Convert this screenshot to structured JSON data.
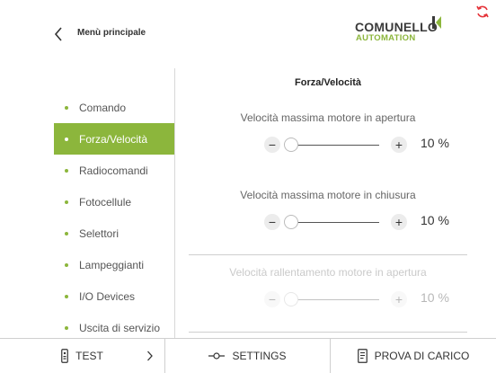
{
  "header": {
    "back_title": "Menù principale",
    "logo_word": "COMUNELLO",
    "logo_sub": "AUTOMATION",
    "brand_color": "#8cb63c",
    "sync_icon_color": "#e5343a"
  },
  "sidebar": {
    "items": [
      {
        "label": "Comando",
        "active": false
      },
      {
        "label": "Forza/Velocità",
        "active": true
      },
      {
        "label": "Radiocomandi",
        "active": false
      },
      {
        "label": "Fotocellule",
        "active": false
      },
      {
        "label": "Selettori",
        "active": false
      },
      {
        "label": "Lampeggianti",
        "active": false
      },
      {
        "label": "I/O Devices",
        "active": false
      },
      {
        "label": "Uscita di servizio",
        "active": false
      }
    ]
  },
  "panel": {
    "title": "Forza/Velocità",
    "settings": [
      {
        "label": "Velocità massima motore in apertura",
        "value": "10 %",
        "level": 0,
        "minus": "−",
        "plus": "+",
        "enabled": true
      },
      {
        "label": "Velocità massima motore in chiusura",
        "value": "10 %",
        "level": 0,
        "minus": "−",
        "plus": "+",
        "enabled": true
      },
      {
        "label": "Velocità rallentamento motore in apertura",
        "value": "10 %",
        "level": 0,
        "minus": "−",
        "plus": "+",
        "enabled": false
      }
    ]
  },
  "bottom_bar": {
    "test_label": "TEST",
    "settings_label": "SETTINGS",
    "load_test_label": "PROVA DI CARICO"
  }
}
